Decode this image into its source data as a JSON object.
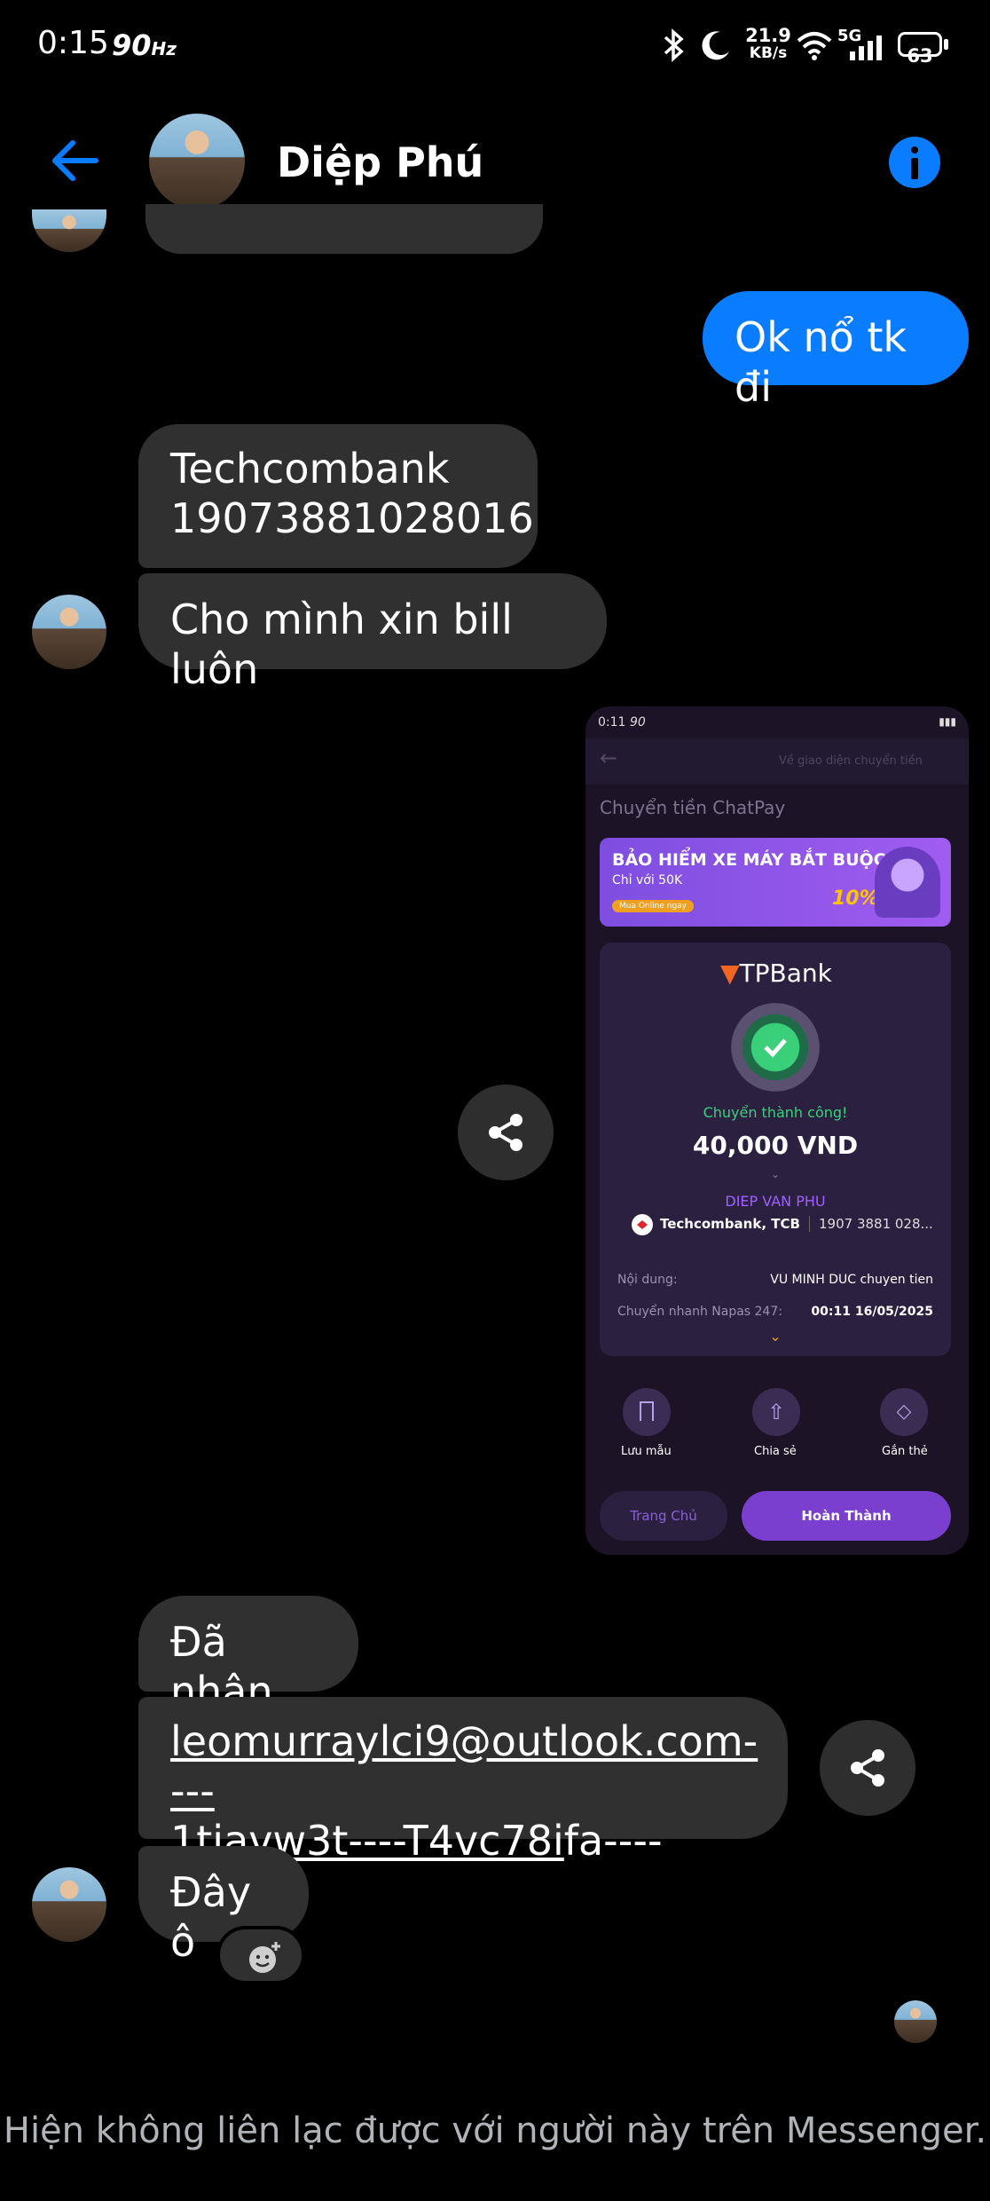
{
  "status_bar": {
    "time": "0:15",
    "refresh_rate": "90",
    "refresh_unit": "Hz",
    "net_speed": "21.9",
    "net_unit": "KB/s",
    "network": "5G",
    "battery": "63"
  },
  "header": {
    "contact_name": "Diệp Phú"
  },
  "messages": {
    "out_1": "Ok nổ tk đi",
    "in_1_line1": "Techcombank",
    "in_1_line2": "19073881028016",
    "in_2": "Cho mình xin bill luôn",
    "in_3": "Đã nhận",
    "in_4_line1": "leomurraylci9@outlook.com----",
    "in_4_line2_link": "1tjavw3t----T4vc78i",
    "in_4_line2_rest": "fa----",
    "in_5": "Đây ô"
  },
  "receipt": {
    "time": "0:11",
    "refresh": "90",
    "switch_ui": "Về giao diện chuyển tiền",
    "title": "Chuyển tiền ChatPay",
    "banner_title": "BẢO HIỂM XE MÁY BẮT BUỘC",
    "banner_sub": "Chỉ với 50K",
    "banner_cta": "Mua Online ngay",
    "banner_pct": "10%",
    "bank_logo": "TPBank",
    "success": "Chuyển thành công!",
    "amount": "40,000 VND",
    "recipient": "DIEP VAN PHU",
    "bank": "Techcombank, TCB",
    "account": "1907 3881 028...",
    "content_label": "Nội dung:",
    "content_value": "VU MINH DUC chuyen tien",
    "napas_label": "Chuyển nhanh Napas 247:",
    "napas_value": "00:11 16/05/2025",
    "action_save": "Lưu mẫu",
    "action_share": "Chia sẻ",
    "action_tag": "Gắn thẻ",
    "btn_home": "Trang Chủ",
    "btn_done": "Hoàn Thành"
  },
  "footer": {
    "notice": "Hiện không liên lạc được với người này trên Messenger."
  },
  "colors": {
    "messenger_blue": "#0a7cff",
    "bubble_gray": "#303030",
    "tp_purple": "#7b3fd0"
  }
}
